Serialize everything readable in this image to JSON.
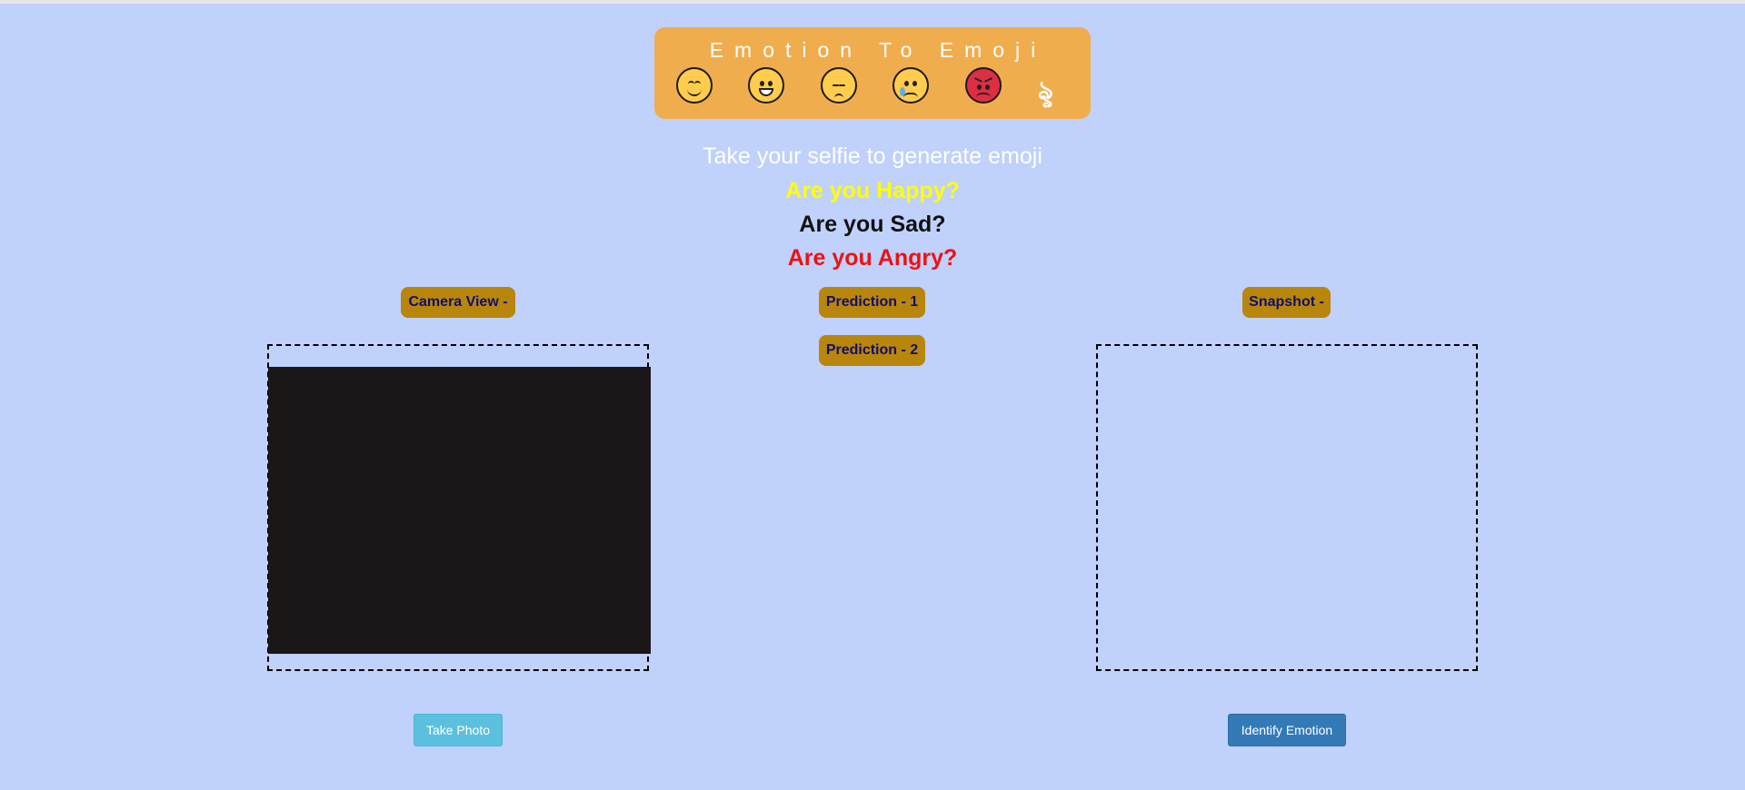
{
  "header": {
    "title": "Emotion To Emoji",
    "emojis": [
      "smiling-face-icon",
      "grinning-face-icon",
      "pensive-face-icon",
      "crying-face-icon",
      "angry-face-icon",
      "squiggle-icon"
    ],
    "squiggle_glyph": "ৡ"
  },
  "prompts": {
    "subtitle": "Take your selfie to generate emoji",
    "happy": "Are you Happy?",
    "sad": "Are you Sad?",
    "angry": "Are you Angry?"
  },
  "labels": {
    "camera_view": "Camera View -",
    "prediction_1": "Prediction - 1",
    "prediction_2": "Prediction - 2",
    "snapshot": "Snapshot -"
  },
  "buttons": {
    "take_photo": "Take Photo",
    "identify_emotion": "Identify Emotion"
  },
  "colors": {
    "background": "#c0d1fc",
    "header": "#f0ad4e",
    "label_pill": "#b8860b",
    "happy": "#ffff00",
    "sad": "#111111",
    "angry": "#ee1111",
    "take_photo_button": "#5bc0de",
    "identify_button": "#337ab7"
  }
}
